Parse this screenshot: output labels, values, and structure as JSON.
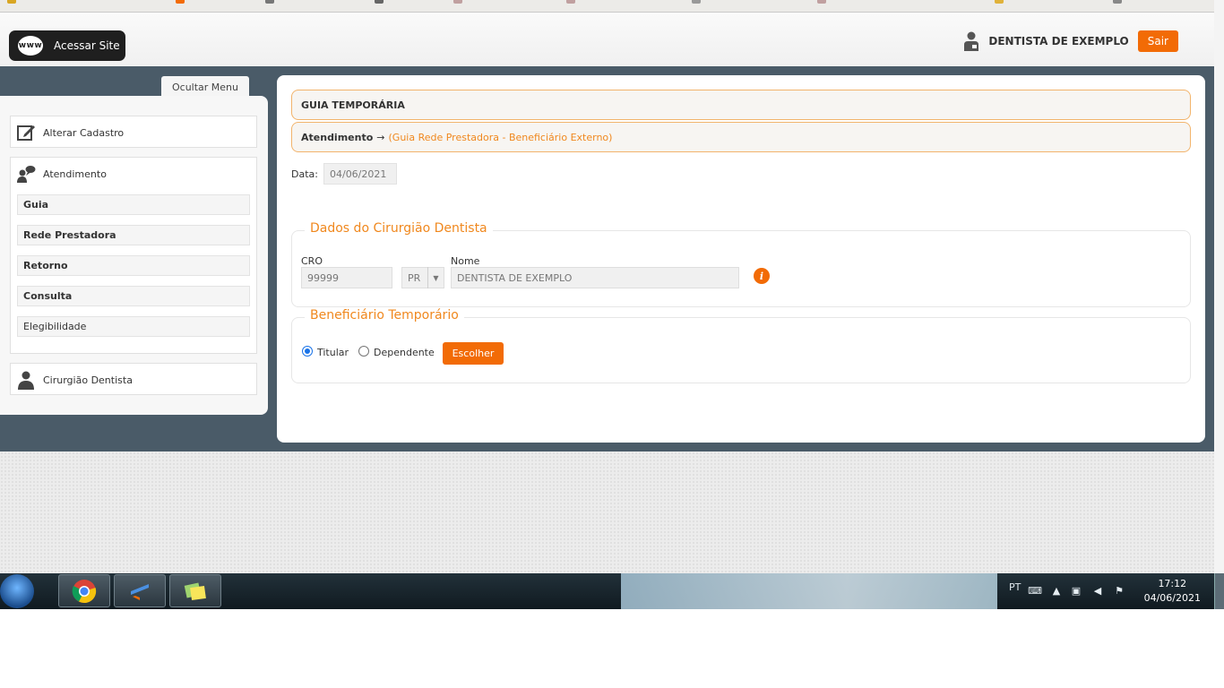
{
  "header": {
    "site_button": "Acessar Site",
    "www_badge": "www",
    "user_name": "DENTISTA DE EXEMPLO",
    "logout": "Sair"
  },
  "sidebar": {
    "toggle": "Ocultar Menu",
    "edit_profile": "Alterar Cadastro",
    "service": "Atendimento",
    "service_items": [
      "Guia",
      "Rede Prestadora",
      "Retorno",
      "Consulta",
      "Elegibilidade"
    ],
    "dentist": "Cirurgião Dentista"
  },
  "main": {
    "title": "GUIA TEMPORÁRIA",
    "breadcrumb_root": "Atendimento",
    "breadcrumb_arrow": "→",
    "breadcrumb_detail": "(Guia Rede Prestadora - Beneficiário Externo)",
    "date_label": "Data:",
    "date_value": "04/06/2021",
    "dentist_section": {
      "legend": "Dados do Cirurgião Dentista",
      "cro_label": "CRO",
      "cro_value": "99999",
      "state_value": "PR",
      "name_label": "Nome",
      "name_value": "DENTISTA DE EXEMPLO"
    },
    "beneficiary_section": {
      "legend": "Beneficiário Temporário",
      "option_holder": "Titular",
      "option_dependent": "Dependente",
      "selected": "Titular",
      "choose_button": "Escolher"
    }
  },
  "taskbar": {
    "language": "PT",
    "time": "17:12",
    "date": "04/06/2021"
  },
  "colors": {
    "accent": "#f26b06",
    "legend": "#f0881e",
    "backdrop": "#4a5b68"
  }
}
